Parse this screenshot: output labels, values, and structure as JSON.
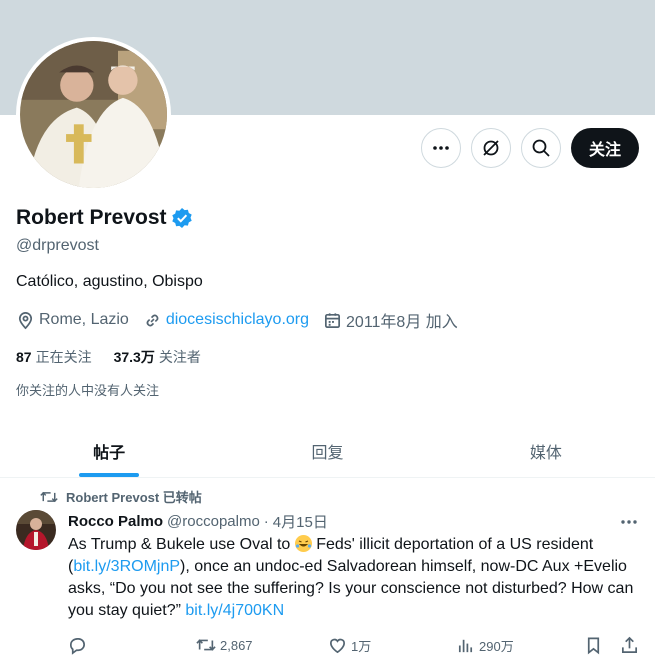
{
  "profile": {
    "name": "Robert Prevost",
    "handle": "@drprevost",
    "bio": "Católico, agustino, Obispo",
    "location": "Rome, Lazio",
    "website": "diocesischiclayo.org",
    "joined": "2011年8月 加入",
    "following_count": "87",
    "following_label": "正在关注",
    "followers_count": "37.3万",
    "followers_label": "关注者",
    "followed_note": "你关注的人中没有人关注",
    "verified_color": "#1d9bf0"
  },
  "actions": {
    "follow_label": "关注",
    "more_icon": "more-icon",
    "grok_icon": "grok-icon",
    "search_icon": "search-icon"
  },
  "tabs": [
    {
      "label": "帖子",
      "active": true
    },
    {
      "label": "回复",
      "active": false
    },
    {
      "label": "媒体",
      "active": false
    }
  ],
  "tweet": {
    "retweeted_by": "Robert Prevost 已转帖",
    "author_name": "Rocco Palmo",
    "author_handle": "@roccopalmo",
    "dot": "·",
    "date": "4月15日",
    "text_part1": "As Trump & Bukele use Oval to",
    "text_part2": "Feds' illicit deportation of a US resident (",
    "link1": "bit.ly/3ROMjnP",
    "text_part3": "), once an undoc-ed Salvadorean himself, now-DC Aux +Evelio asks, “Do you not see the suffering? Is your conscience not disturbed? How can you stay quiet?”",
    "link2": "bit.ly/4j700KN",
    "emoji_icon": "rofl-emoji-icon",
    "retweets": "2,867",
    "likes": "1万",
    "views": "290万"
  },
  "colors": {
    "accent": "#1d9bf0",
    "text": "#0f1419",
    "muted": "#536471",
    "banner": "#cfd9de"
  }
}
